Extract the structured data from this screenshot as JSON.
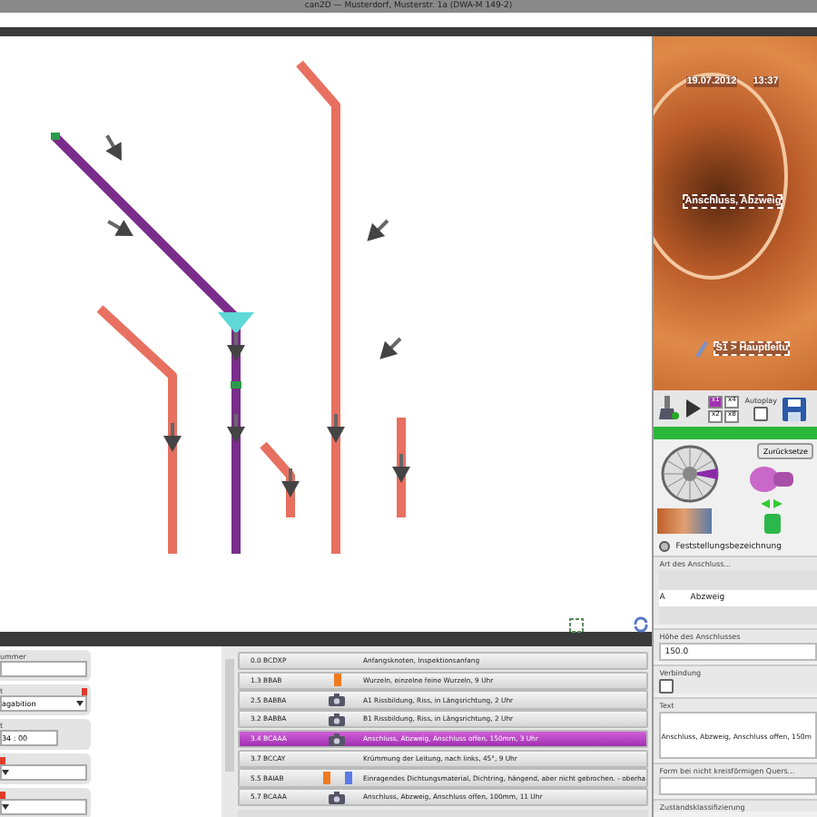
{
  "window": {
    "title": "can2D — Musterdorf, Musterstr. 1a (DWA-M 149-2)"
  },
  "video": {
    "date": "19.07.2012",
    "time": "13:37",
    "overlay_text": "Anschluss, Abzweig",
    "section": "S1 > Hauptleitu"
  },
  "player": {
    "speeds": [
      {
        "label": "x1",
        "selected": true
      },
      {
        "label": "x4",
        "selected": false
      },
      {
        "label": "x2",
        "selected": false
      },
      {
        "label": "x8",
        "selected": false
      }
    ],
    "autoplay_label": "Autoplay",
    "autoplay": false,
    "reset_label": "Zurücksetze"
  },
  "details": {
    "header": "Feststellungsbezeichnung",
    "expanded": true,
    "fields": [
      {
        "kind": "list",
        "label": "Art des Anschluss...",
        "code": "A",
        "value": "Abzweig"
      },
      {
        "kind": "input",
        "label": "Höhe des Anschlusses",
        "value": "150.0"
      },
      {
        "kind": "checkbox",
        "label": "Verbindung",
        "checked": false
      },
      {
        "kind": "textarea",
        "label": "Text",
        "value": "Anschluss, Abzweig, Anschluss offen, 150m"
      },
      {
        "kind": "input",
        "label": "Form bei nicht kreisförmigen Quers..."
      },
      {
        "kind": "header",
        "label": "Zustandsklassifizierung"
      }
    ]
  },
  "left_form": [
    {
      "kind": "input",
      "label": "ummer",
      "required": false
    },
    {
      "kind": "select",
      "label": "t",
      "value": "agabition",
      "required": true
    },
    {
      "kind": "time",
      "label": "t",
      "value": "34 : 00",
      "required": false
    },
    {
      "kind": "select",
      "required": true
    },
    {
      "kind": "select",
      "required": true
    }
  ],
  "observations": [
    {
      "code": "0.0 BCDXP",
      "text": "Anfangsknoten, Inspektionsanfang",
      "selected": false
    },
    {
      "code": "1.3 BBAB",
      "icons": [
        {
          "kind": "marker",
          "color": "#f07a20"
        }
      ],
      "text": "Wurzeln, einzelne feine Wurzeln, 9 Uhr",
      "selected": false
    },
    {
      "code": "2.5 BABBA",
      "icons": [
        {
          "kind": "camera"
        }
      ],
      "text": "A1 Rissbildung, Riss, in Längsrichtung, 2 Uhr",
      "selected": false
    },
    {
      "code": "3.2 BABBA",
      "icons": [
        {
          "kind": "camera"
        }
      ],
      "text": "B1 Rissbildung, Riss, in Längsrichtung, 2 Uhr",
      "selected": false
    },
    {
      "code": "3.4 BCAAA",
      "icons": [
        {
          "kind": "camera"
        }
      ],
      "text": "Anschluss, Abzweig, Anschluss offen, 150mm, 3 Uhr",
      "selected": true
    },
    {
      "code": "3.7 BCCAY",
      "text": "Krümmung der Leitung, nach links, 45°, 9 Uhr",
      "selected": false
    },
    {
      "code": "5.5 BAIAB",
      "icons": [
        {
          "kind": "marker",
          "color": "#f07a20"
        },
        {
          "kind": "marker",
          "color": "#5a7ae8"
        }
      ],
      "text": "Einragendes Dichtungsmaterial, Dichtring, hängend, aber nicht gebrochen. - oberha",
      "selected": false
    },
    {
      "code": "5.7 BCAAA",
      "icons": [
        {
          "kind": "camera"
        }
      ],
      "text": "Anschluss, Abzweig, Anschluss offen, 100mm, 11 Uhr",
      "selected": false
    }
  ]
}
